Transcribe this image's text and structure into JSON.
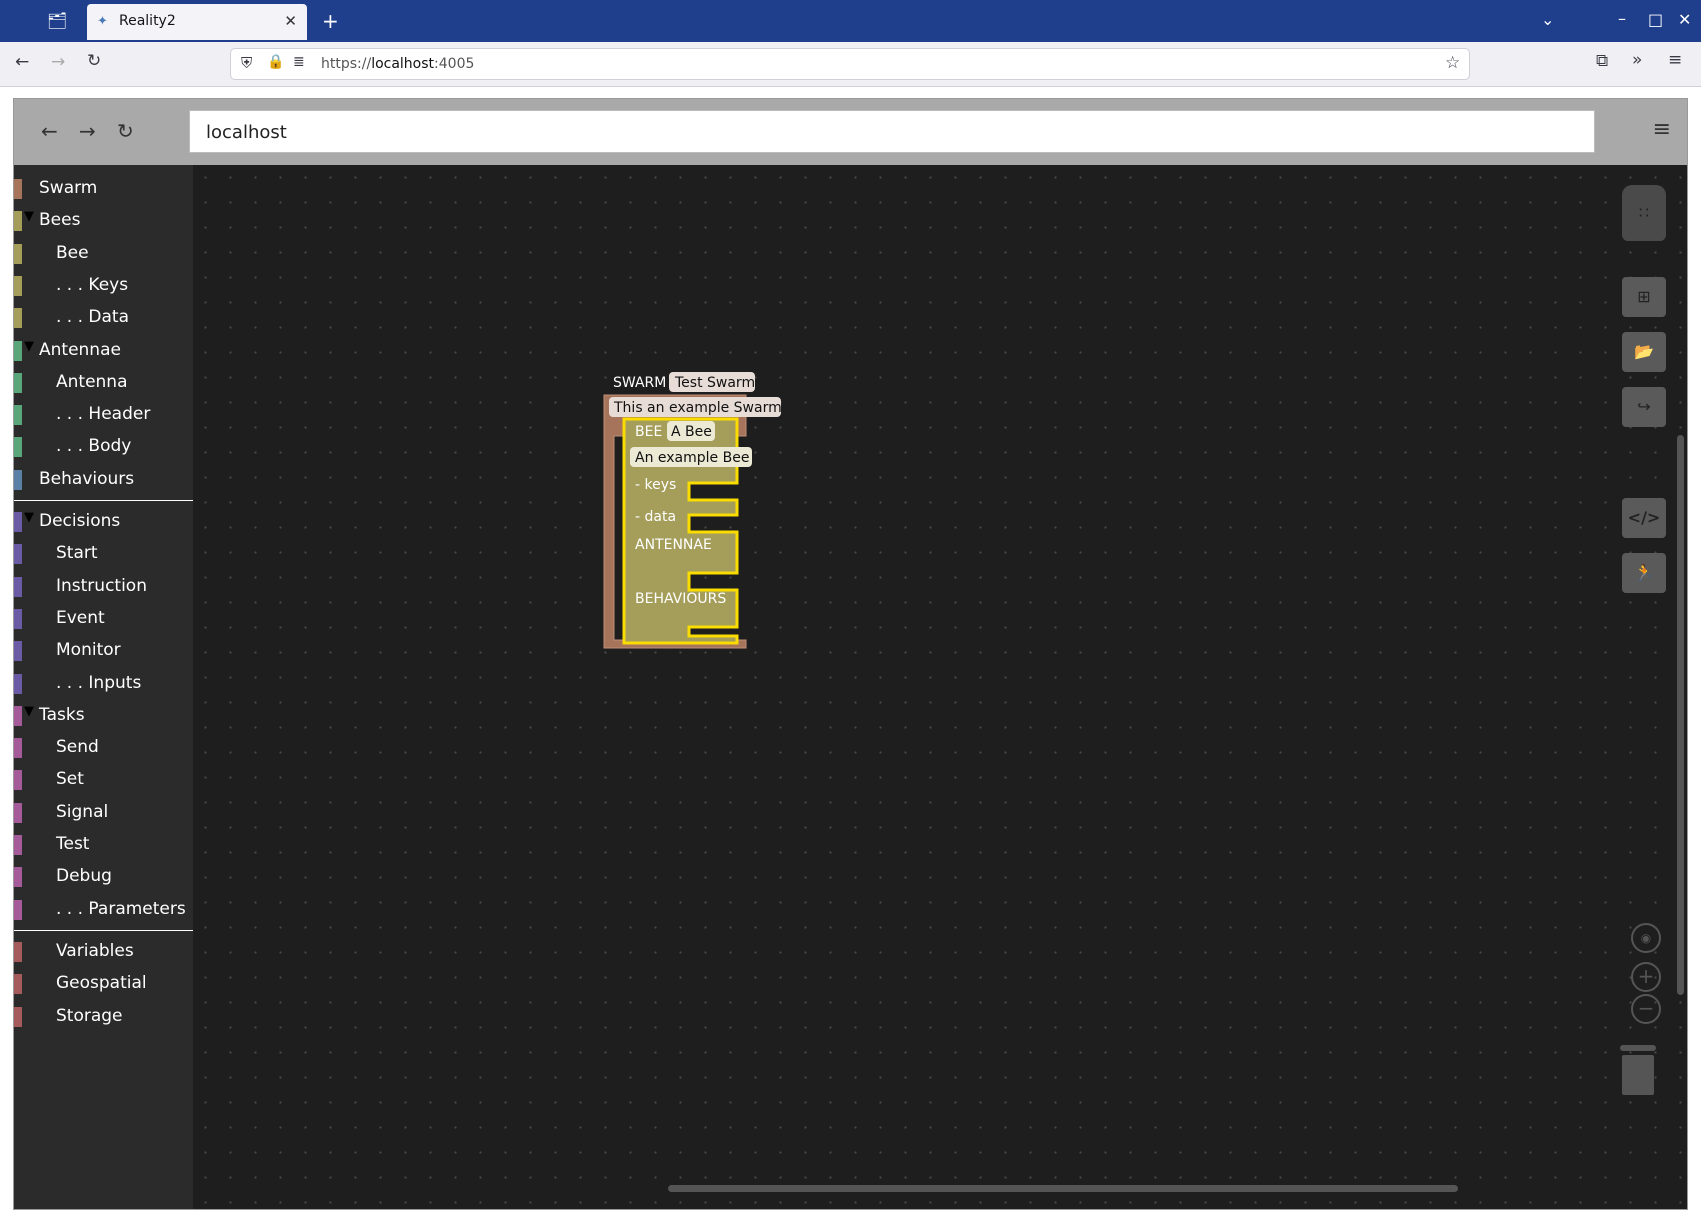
{
  "browser": {
    "tab_title": "Reality2",
    "url_prefix": "https://",
    "url_host": "localhost",
    "url_port": ":4005"
  },
  "app": {
    "address": "localhost"
  },
  "toolbox": {
    "categories": [
      {
        "label": "Swarm",
        "color": "#a5745b"
      },
      {
        "label": "Bees",
        "color": "#a59e5b",
        "expanded": true
      },
      {
        "label": "Bee",
        "color": "#a59e5b"
      },
      {
        "label": ". . . Keys",
        "color": "#a59e5b"
      },
      {
        "label": ". . . Data",
        "color": "#a59e5b"
      },
      {
        "label": "Antennae",
        "color": "#5ba57a",
        "expanded": true
      },
      {
        "label": "Antenna",
        "color": "#5ba57a"
      },
      {
        "label": ". . . Header",
        "color": "#5ba57a"
      },
      {
        "label": ". . . Body",
        "color": "#5ba57a"
      },
      {
        "label": "Behaviours",
        "color": "#5b80a5"
      },
      {
        "label": "Decisions",
        "color": "#6b5ba5",
        "expanded": true
      },
      {
        "label": "Start",
        "color": "#6b5ba5"
      },
      {
        "label": "Instruction",
        "color": "#6b5ba5"
      },
      {
        "label": "Event",
        "color": "#6b5ba5"
      },
      {
        "label": "Monitor",
        "color": "#6b5ba5"
      },
      {
        "label": ". . . Inputs",
        "color": "#6b5ba5"
      },
      {
        "label": "Tasks",
        "color": "#a55b99",
        "expanded": true
      },
      {
        "label": "Send",
        "color": "#a55b99"
      },
      {
        "label": "Set",
        "color": "#a55b99"
      },
      {
        "label": "Signal",
        "color": "#a55b99"
      },
      {
        "label": "Test",
        "color": "#a55b99"
      },
      {
        "label": "Debug",
        "color": "#a55b99"
      },
      {
        "label": ". . . Parameters",
        "color": "#a55b99"
      },
      {
        "label": "Variables",
        "color": "#a55b5b"
      },
      {
        "label": "Geospatial",
        "color": "#a55b5b"
      },
      {
        "label": "Storage",
        "color": "#a55b5b"
      }
    ]
  },
  "blocks": {
    "swarm_keyword": "SWARM",
    "swarm_name": "Test Swarm",
    "swarm_description": "This an example Swarm",
    "bee_keyword": "BEE",
    "bee_name": "A Bee",
    "bee_description": "An example Bee",
    "keys_label": "- keys",
    "data_label": "- data",
    "antennae_label": "ANTENNAE",
    "behaviours_label": "BEHAVIOURS",
    "swarm_color": "#a5745b",
    "bee_color": "#a59e5b",
    "highlight_color": "#fadc00"
  },
  "icons": {
    "backpack": "backpack-icon",
    "grid": "grid-icon",
    "folder": "folder-open-icon",
    "share": "share-icon",
    "code": "code-icon",
    "run": "run-icon",
    "recenter": "recenter-icon",
    "zoom_in": "zoom-in-icon",
    "zoom_out": "zoom-out-icon",
    "trash": "trash-icon"
  }
}
